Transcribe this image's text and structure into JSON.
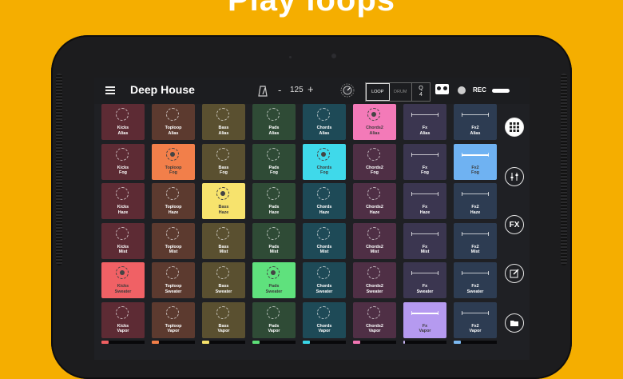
{
  "headline": "Play loops",
  "app": {
    "title": "Deep House",
    "tempo": "125",
    "tempo_minus": "-",
    "tempo_plus": "+",
    "mode_loop": "LOOP",
    "mode_drum": "DRUM",
    "quantize_label": "Q",
    "quantize_value": "4",
    "rec_label": "REC"
  },
  "columns": [
    {
      "name": "Kicks",
      "color": "#5d2b34",
      "lit": "#f06165",
      "meter": "#ee5f62",
      "shape": "circle"
    },
    {
      "name": "Toploop",
      "color": "#5c3a2f",
      "lit": "#f27f4a",
      "meter": "#f07e48",
      "shape": "circle"
    },
    {
      "name": "Bass",
      "color": "#5a5030",
      "lit": "#f7e36d",
      "meter": "#f4e06a",
      "shape": "circle"
    },
    {
      "name": "Pads",
      "color": "#2f4b36",
      "lit": "#5fe17d",
      "meter": "#5cde78",
      "shape": "circle"
    },
    {
      "name": "Chords",
      "color": "#1e4a57",
      "lit": "#3fd9ea",
      "meter": "#39d4e6",
      "shape": "circle"
    },
    {
      "name": "Chords2",
      "color": "#4f2f45",
      "lit": "#f37ab8",
      "meter": "#f075b3",
      "shape": "circle"
    },
    {
      "name": "Fx",
      "color": "#3b3650",
      "lit": "#b59af0",
      "meter": "#c8b6f2",
      "shape": "line"
    },
    {
      "name": "Fx2",
      "color": "#2d3c52",
      "lit": "#6fb2f2",
      "meter": "#7bb8f0",
      "shape": "line"
    }
  ],
  "rows": [
    "Alias",
    "Fog",
    "Haze",
    "Mist",
    "Sweater",
    "Vapor"
  ],
  "active_pads": [
    [
      5,
      0
    ],
    [
      1,
      1
    ],
    [
      4,
      1
    ],
    [
      7,
      1
    ],
    [
      2,
      2
    ],
    [
      0,
      4
    ],
    [
      3,
      4
    ],
    [
      6,
      5
    ]
  ],
  "side_buttons": [
    {
      "name": "grid-view-button",
      "icon": "grid-icon"
    },
    {
      "name": "mixer-button",
      "icon": "sliders-icon"
    },
    {
      "name": "fx-button",
      "icon": "fx-icon",
      "label": "FX"
    },
    {
      "name": "edit-button",
      "icon": "edit-icon"
    },
    {
      "name": "browse-button",
      "icon": "folder-icon"
    }
  ],
  "colors": {
    "background": "#F5AE00",
    "screen": "#1f2024"
  }
}
